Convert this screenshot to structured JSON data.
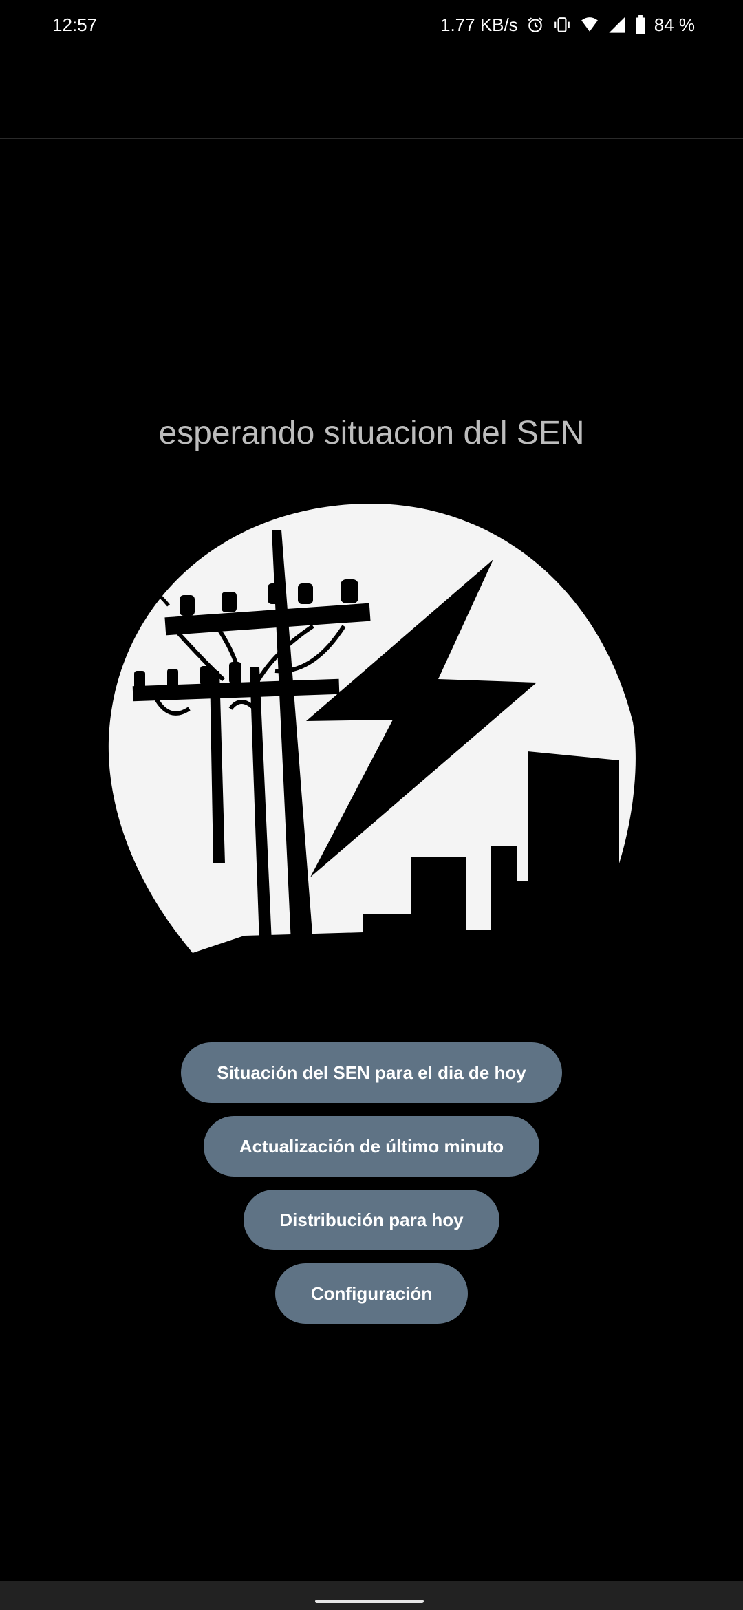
{
  "status_bar": {
    "time": "12:57",
    "net_speed": "1.77 KB/s",
    "battery": "84 %",
    "icons": [
      "alarm-icon",
      "vibrate-icon",
      "wifi-icon",
      "signal-icon",
      "battery-icon"
    ]
  },
  "main": {
    "status_message": "esperando situacion del SEN",
    "logo": "power-lines-lightning-city-logo"
  },
  "menu": {
    "buttons": [
      {
        "label": "Situación del SEN para el dia de hoy"
      },
      {
        "label": "Actualización de último minuto"
      },
      {
        "label": "Distribución para hoy"
      },
      {
        "label": "Configuración"
      }
    ]
  },
  "colors": {
    "background": "#000000",
    "button": "#5f7385",
    "status_text": "#bdbdbd",
    "logo_circle": "#f4f4f4"
  }
}
